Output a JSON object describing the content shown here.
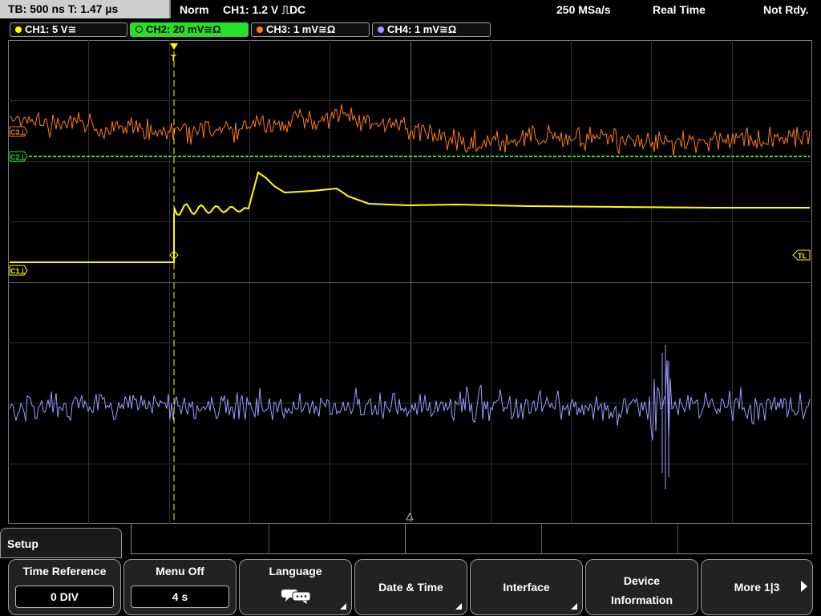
{
  "status": {
    "timebase": "TB: 500 ns   T: 1.47 µs",
    "trigger_mode": "Norm",
    "trigger_info": "CH1: 1.2 V ⎍DC",
    "sample_rate": "250 MSa/s",
    "acq_mode": "Real Time",
    "state": "Not Rdy."
  },
  "channels": [
    {
      "label": "CH1: 5 V≅",
      "color": "#ffff00"
    },
    {
      "label": "CH2: 20 mV≅Ω",
      "color": "#28e028"
    },
    {
      "label": "CH3: 1 mV≅Ω",
      "color": "#ff7a1a"
    },
    {
      "label": "CH4: 1 mV≅Ω",
      "color": "#9b9bff"
    }
  ],
  "markers": {
    "c3": "C3⊥",
    "c2": "C2⊥",
    "c1": "C1⊥",
    "trigger_level": "TL",
    "trigger_top": "T"
  },
  "menu": {
    "title": "Setup",
    "softkeys": [
      {
        "label": "Time Reference",
        "value": "0 DIV"
      },
      {
        "label": "Menu Off",
        "value": "4 s"
      },
      {
        "label": "Language",
        "icon": "speech-bubbles-icon"
      },
      {
        "label": "Date & Time"
      },
      {
        "label": "Interface"
      },
      {
        "label_line1": "Device",
        "label_line2": "Information"
      },
      {
        "label": "More 1|3"
      }
    ]
  }
}
